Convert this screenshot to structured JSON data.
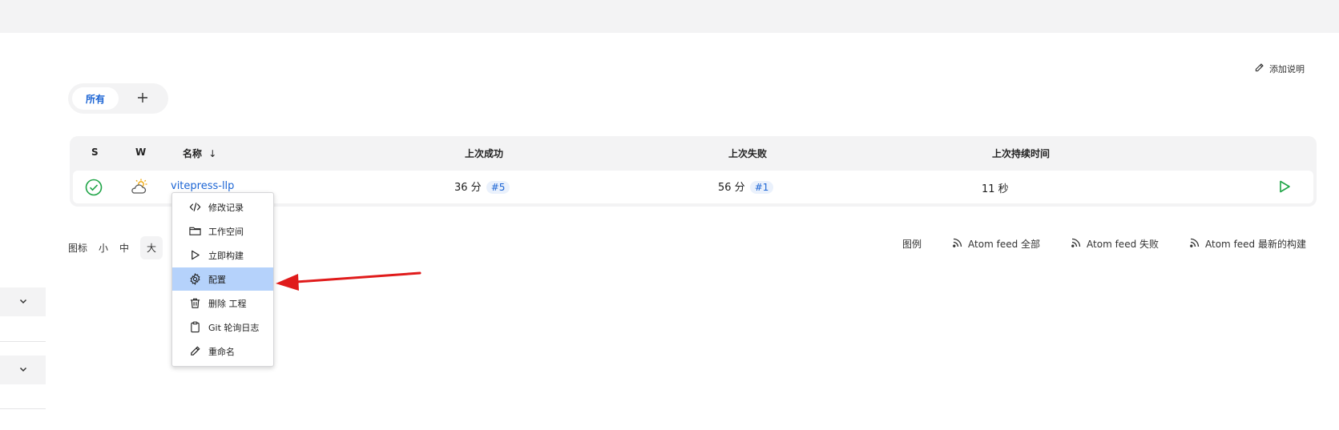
{
  "header": {
    "add_description": "添加说明"
  },
  "views": {
    "tab_all": "所有",
    "add_icon": "plus-icon"
  },
  "table": {
    "headers": {
      "s": "S",
      "w": "W",
      "name": "名称",
      "name_sort": "↓",
      "last_success": "上次成功",
      "last_failure": "上次失败",
      "last_duration": "上次持续时间"
    },
    "rows": [
      {
        "status_icon": "success-check-icon",
        "weather_icon": "partly-cloudy-icon",
        "name": "vitepress-llp",
        "last_success_time": "36 分",
        "last_success_build": "#5",
        "last_failure_time": "56 分",
        "last_failure_build": "#1",
        "last_duration": "11 秒",
        "build_icon": "play-icon"
      }
    ]
  },
  "icon_size": {
    "label": "图标",
    "small": "小",
    "medium": "中",
    "large": "大"
  },
  "legend": {
    "legend_label": "图例",
    "feed_all": "Atom feed 全部",
    "feed_failed": "Atom feed 失败",
    "feed_latest": "Atom feed 最新的构建"
  },
  "context_menu": {
    "items": [
      {
        "label": "修改记录",
        "icon": "code-icon"
      },
      {
        "label": "工作空间",
        "icon": "folder-icon"
      },
      {
        "label": "立即构建",
        "icon": "play-icon"
      },
      {
        "label": "配置",
        "icon": "gear-icon",
        "highlighted": true
      },
      {
        "label": "删除 工程",
        "icon": "trash-icon"
      },
      {
        "label": "Git 轮询日志",
        "icon": "clipboard-icon"
      },
      {
        "label": "重命名",
        "icon": "pencil-icon"
      }
    ]
  },
  "colors": {
    "accent": "#1b64d4",
    "success": "#1ea446",
    "menu_highlight": "#b5d2fb",
    "arrow": "#e01b1b"
  }
}
